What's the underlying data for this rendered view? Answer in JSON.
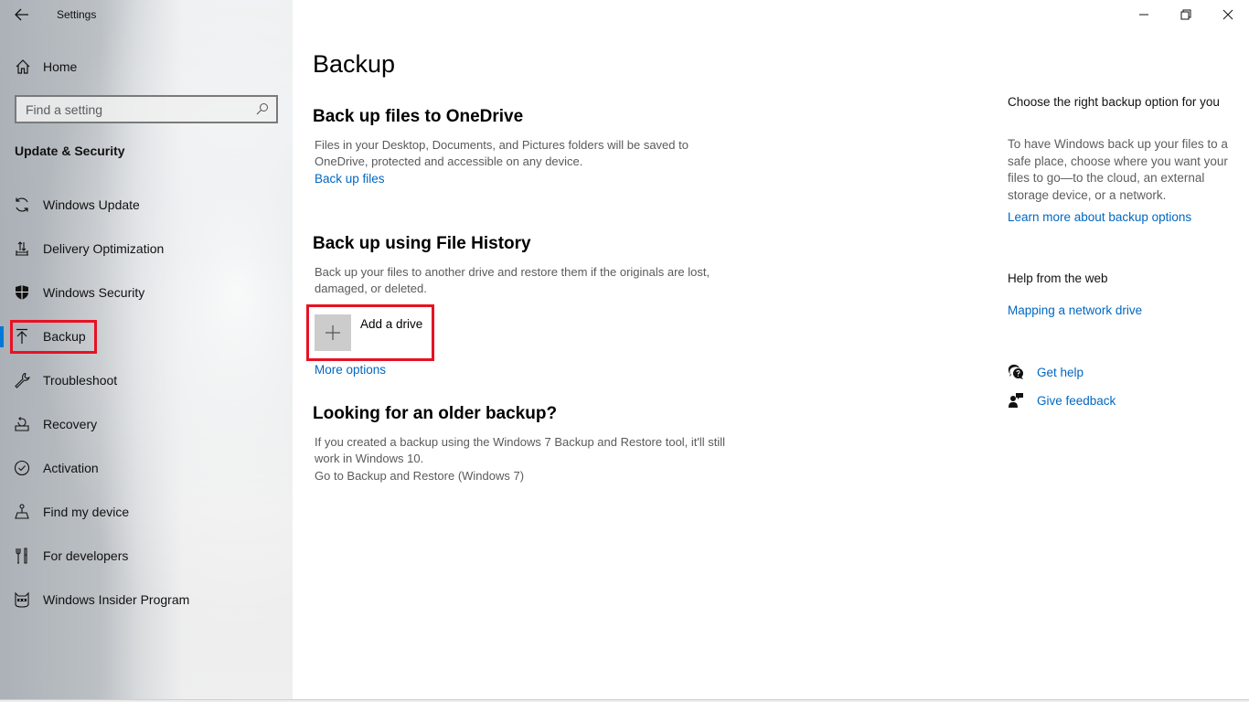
{
  "window": {
    "title": "Settings",
    "controls": {
      "minimize": "minimize-icon",
      "restore": "restore-icon",
      "close": "close-icon"
    }
  },
  "sidebar": {
    "back_icon": "back-arrow-icon",
    "home_label": "Home",
    "search": {
      "value": "",
      "placeholder": "Find a setting"
    },
    "section_title": "Update & Security",
    "items": [
      {
        "label": "Windows Update",
        "icon": "sync-icon",
        "active": false
      },
      {
        "label": "Delivery Optimization",
        "icon": "delivery-optimization-icon",
        "active": false
      },
      {
        "label": "Windows Security",
        "icon": "shield-icon",
        "active": false
      },
      {
        "label": "Backup",
        "icon": "upload-arrow-icon",
        "active": true
      },
      {
        "label": "Troubleshoot",
        "icon": "wrench-icon",
        "active": false
      },
      {
        "label": "Recovery",
        "icon": "recovery-icon",
        "active": false
      },
      {
        "label": "Activation",
        "icon": "check-circle-icon",
        "active": false
      },
      {
        "label": "Find my device",
        "icon": "find-device-icon",
        "active": false
      },
      {
        "label": "For developers",
        "icon": "developer-tools-icon",
        "active": false
      },
      {
        "label": "Windows Insider Program",
        "icon": "insider-ninjacat-icon",
        "active": false
      }
    ]
  },
  "main": {
    "title": "Backup",
    "onedrive": {
      "heading": "Back up files to OneDrive",
      "description": "Files in your Desktop, Documents, and Pictures folders will be saved to OneDrive, protected and accessible on any device.",
      "link": "Back up files"
    },
    "file_history": {
      "heading": "Back up using File History",
      "description": "Back up your files to another drive and restore them if the originals are lost, damaged, or deleted.",
      "add_drive_label": "Add a drive",
      "more_options": "More options"
    },
    "older_backup": {
      "heading": "Looking for an older backup?",
      "description": "If you created a backup using the Windows 7 Backup and Restore tool, it'll still work in Windows 10.",
      "link": "Go to Backup and Restore (Windows 7)"
    }
  },
  "aside": {
    "choose_heading": "Choose the right backup option for you",
    "choose_text": "To have Windows back up your files to a safe place, choose where you want your files to go—to the cloud, an external storage device, or a network.",
    "learn_more": "Learn more about backup options",
    "help_heading": "Help from the web",
    "help_link": "Mapping a network drive",
    "get_help": "Get help",
    "give_feedback": "Give feedback"
  },
  "colors": {
    "accent": "#0078d7",
    "link": "#0067c0",
    "highlight": "#e81123",
    "tile": "#cccccc"
  }
}
